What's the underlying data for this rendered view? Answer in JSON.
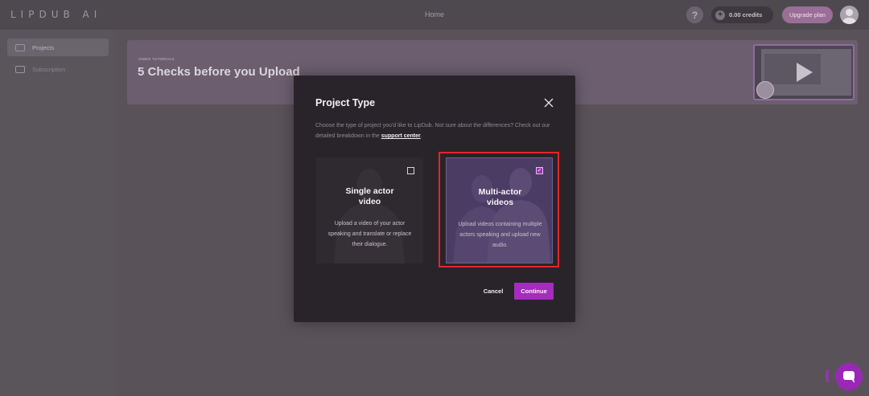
{
  "app": {
    "logo": "LIPDUB AI",
    "nav_home": "Home",
    "help_symbol": "?",
    "credits": "0.00 credits",
    "upgrade_label": "Upgrade plan"
  },
  "sidebar": {
    "items": [
      {
        "label": "Projects",
        "icon": "folder-icon",
        "active": true
      },
      {
        "label": "Subscription",
        "icon": "card-icon",
        "active": false
      }
    ]
  },
  "banner": {
    "kicker": "VIDEO TUTORIALS",
    "title": "5 Checks before you Upload"
  },
  "modal": {
    "title": "Project Type",
    "description": "Choose the type of project you'd like to LipDub. Not sure about the differences? Check out our detailed breakdown in the",
    "link_text": "support center",
    "link_suffix": ".",
    "options": [
      {
        "title_line1": "Single actor",
        "title_line2": "video",
        "text": "Upload a video of your actor speaking and translate or replace their dialogue.",
        "selected": false
      },
      {
        "title_line1": "Multi-actor",
        "title_line2": "videos",
        "text": "Upload videos containing multiple actors speaking and upload new audio.",
        "selected": true
      }
    ],
    "cancel_label": "Cancel",
    "continue_label": "Continue"
  },
  "colors": {
    "accent": "#a42cbe",
    "selection_highlight": "#e3262b",
    "modal_bg": "#292429"
  }
}
